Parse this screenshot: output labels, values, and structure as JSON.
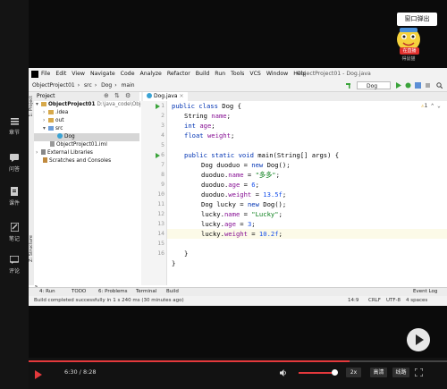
{
  "sidebar": {
    "items": [
      {
        "label": "章节",
        "icon": "list-icon"
      },
      {
        "label": "问答",
        "icon": "chat-icon"
      },
      {
        "label": "课件",
        "icon": "document-icon"
      },
      {
        "label": "笔记",
        "icon": "note-icon"
      },
      {
        "label": "评论",
        "icon": "comment-icon"
      }
    ]
  },
  "overlay": {
    "popout_label": "窗口弹出",
    "live_badge": "在直播",
    "streamer_name": "得鼠猫"
  },
  "ide": {
    "menu": [
      "File",
      "Edit",
      "View",
      "Navigate",
      "Code",
      "Analyze",
      "Refactor",
      "Build",
      "Run",
      "Tools",
      "VCS",
      "Window",
      "Help"
    ],
    "window_title": "ObjectProject01 - Dog.java",
    "breadcrumbs": [
      "ObjectProject01",
      "src",
      "Dog",
      "main"
    ],
    "run_config": "Dog",
    "project_header": "Project",
    "tree": [
      {
        "label": "ObjectProject01",
        "suffix": "D:\\java_code\\ObjectProject01",
        "type": "folder"
      },
      {
        "label": ".idea",
        "type": "folder"
      },
      {
        "label": "out",
        "type": "folder"
      },
      {
        "label": "src",
        "type": "folder"
      },
      {
        "label": "Dog",
        "type": "class"
      },
      {
        "label": "ObjectProject01.iml",
        "type": "file"
      },
      {
        "label": "External Libraries",
        "type": "lib"
      },
      {
        "label": "Scratches and Consoles",
        "type": "scratch"
      }
    ],
    "side_tabs": [
      "1: Project",
      "Z: Structure",
      "2: Favorites"
    ],
    "editor_tab": "Dog.java",
    "warning_count": "1",
    "line_numbers": [
      "1",
      "2",
      "3",
      "4",
      "5",
      "6",
      "7",
      "8",
      "9",
      "10",
      "11",
      "12",
      "13",
      "14",
      "15",
      "16"
    ],
    "code": {
      "l1": {
        "kw": "public class ",
        "rest": "Dog {"
      },
      "l2": {
        "plain": "String ",
        "fld": "name",
        "rest": ";"
      },
      "l3": {
        "kw": "int ",
        "fld": "age",
        "rest": ";"
      },
      "l4": {
        "kw": "float ",
        "fld": "weight",
        "rest": ";"
      },
      "l6": {
        "kw": "public static void ",
        "plain": "main(String[] args) {"
      },
      "l7": {
        "plain": "Dog duoduo = ",
        "kw": "new ",
        "rest": "Dog();"
      },
      "l8": {
        "plain": "duoduo.",
        "fld": "name",
        "eq": " = ",
        "str": "\"多多\"",
        "rest": ";"
      },
      "l9": {
        "plain": "duoduo.",
        "fld": "age",
        "eq": " = ",
        "num": "6",
        "rest": ";"
      },
      "l10": {
        "plain": "duoduo.",
        "fld": "weight",
        "eq": " = ",
        "num": "13.5f",
        "rest": ";"
      },
      "l11": {
        "plain": "Dog lucky = ",
        "kw": "new ",
        "rest": "Dog();"
      },
      "l12": {
        "plain": "lucky.",
        "fld": "name",
        "eq": " = ",
        "str": "\"Lucky\"",
        "rest": ";"
      },
      "l13": {
        "plain": "lucky.",
        "fld": "age",
        "eq": " = ",
        "num": "3",
        "rest": ";"
      },
      "l14": {
        "plain": "lucky.",
        "fld": "weight",
        "eq": " = ",
        "num": "10.2f",
        "rest": ";"
      },
      "l16": {
        "plain": "}"
      },
      "l17": {
        "plain": "}"
      }
    },
    "bottom_tabs": [
      "4: Run",
      "TODO",
      "6: Problems",
      "Terminal",
      "Build",
      "Event Log"
    ],
    "status_message": "Build completed successfully in 1 s 240 ms (30 minutes ago)",
    "status_right": [
      "14:9",
      "CRLF",
      "UTF-8",
      "4 spaces"
    ]
  },
  "player": {
    "current_time": "6:30",
    "duration": "8:28",
    "progress": 0.767,
    "volume": 0.85,
    "speed": "2x",
    "quality": "高清",
    "route": "线路",
    "accent": "#e4393c"
  }
}
